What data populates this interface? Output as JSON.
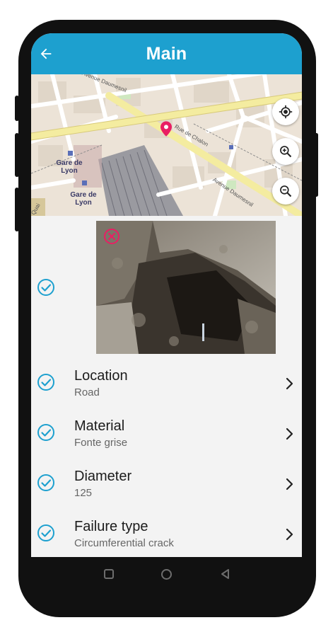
{
  "appbar": {
    "title": "Main",
    "back_icon": "arrow-back-icon"
  },
  "map": {
    "place_label_1": "Gare de Lyon",
    "place_label_2": "Gare de Lyon",
    "street_1": "Avenue Daumesnil",
    "street_2": "Avenue Daumesnil",
    "street_3": "Rue de Chalon",
    "street_4": "Quai",
    "controls": {
      "locate_icon": "my-location-icon",
      "zoom_in_icon": "zoom-in-icon",
      "zoom_out_icon": "zoom-out-icon"
    },
    "marker_color": "#e91e63"
  },
  "photo": {
    "status_icon": "check-circle-icon",
    "delete_icon": "delete-circle-icon"
  },
  "items": [
    {
      "title": "Location",
      "value": "Road"
    },
    {
      "title": "Material",
      "value": "Fonte grise"
    },
    {
      "title": "Diameter",
      "value": "125"
    },
    {
      "title": "Failure type",
      "value": "Circumferential crack"
    }
  ],
  "colors": {
    "primary": "#1da0cf",
    "check": "#1da0cf",
    "accent": "#e91e63"
  },
  "navbar": {
    "recents_icon": "square-icon",
    "home_icon": "circle-icon",
    "back_icon": "triangle-back-icon"
  }
}
